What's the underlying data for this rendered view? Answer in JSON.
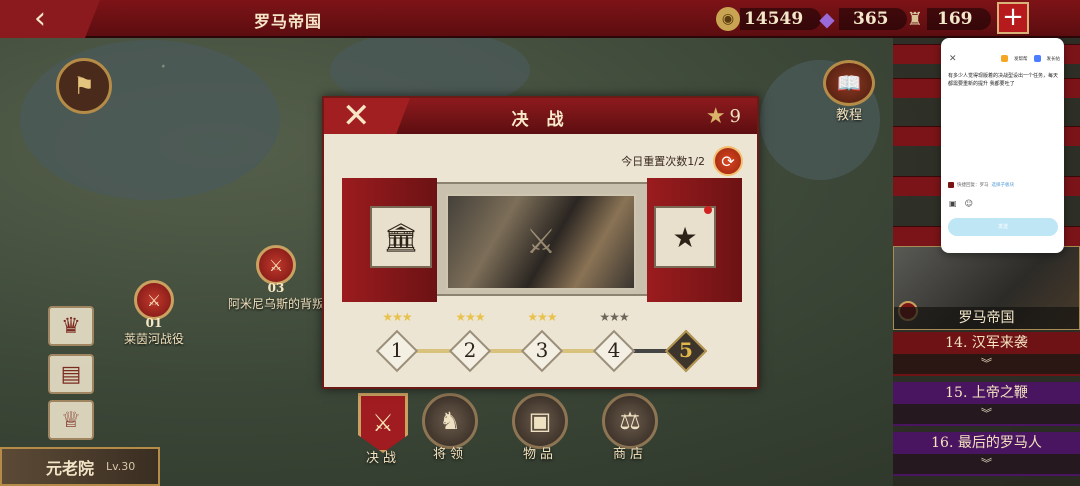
{
  "app": {
    "back_icon": "back-arrow-icon",
    "title": "罗马帝国",
    "resources": [
      {
        "name": "coin",
        "icon": "coin-icon",
        "value": "14549"
      },
      {
        "name": "gem",
        "icon": "gem-icon",
        "value": "365"
      },
      {
        "name": "troops",
        "icon": "troops-icon",
        "value": "169"
      }
    ],
    "plus_label": "+"
  },
  "map": {
    "markers": [
      {
        "num": "01",
        "label": "莱茵河战役"
      },
      {
        "num": "03",
        "label": "阿米尼乌斯的背叛"
      }
    ],
    "tutorial_label": "教程"
  },
  "sidebar": {
    "senate_label": "元老院",
    "senate_level": "Lv.30"
  },
  "bottom_nav": [
    {
      "label": "决战"
    },
    {
      "label": "将领"
    },
    {
      "label": "物品"
    },
    {
      "label": "商店"
    }
  ],
  "chapters": {
    "selected_label": "罗马帝国",
    "items": [
      {
        "title": "14. 汉军来袭"
      },
      {
        "title": "15. 上帝之鞭"
      },
      {
        "title": "16. 最后的罗马人"
      }
    ],
    "arrow": "︾"
  },
  "dialog": {
    "close_label": "✕",
    "title": "决 战",
    "stars_total": "9",
    "reset_text": "今日重置次数1/2",
    "levels": [
      {
        "n": "1",
        "stars": 3,
        "locked": false
      },
      {
        "n": "2",
        "stars": 3,
        "locked": false
      },
      {
        "n": "3",
        "stars": 3,
        "locked": false
      },
      {
        "n": "4",
        "stars": 0,
        "locked": false
      },
      {
        "n": "5",
        "stars": 0,
        "locked": true
      }
    ],
    "colors": {
      "header": "#7d1317",
      "accent": "#d9b36a",
      "panel": "#ede5d3"
    }
  },
  "chat": {
    "close": "✕",
    "tab1": "发帮帮",
    "tab2": "发长帖",
    "message": "有多少人觉得现版着的决战型设出一个任务，每天都需要重新的提升 我都要吐了",
    "source_label": "快捷回复：罗马",
    "source_link": "选择子板块",
    "send_label": "发送"
  }
}
